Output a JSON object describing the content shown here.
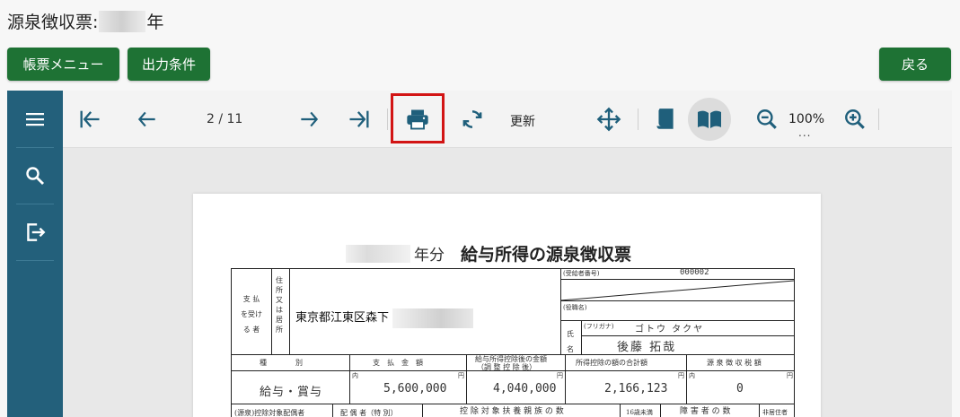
{
  "page": {
    "title_prefix": "源泉徴収票:",
    "title_suffix": "年"
  },
  "buttons": {
    "menu": "帳票メニュー",
    "conditions": "出力条件",
    "back": "戻る"
  },
  "sidebar": {
    "icons": [
      "menu-icon",
      "search-icon",
      "export-icon"
    ]
  },
  "toolbar": {
    "page_indicator": "2 / 11",
    "refresh_label": "更新",
    "zoom_level": "100%",
    "zoom_more": "...",
    "icons": [
      "first-page-icon",
      "prev-page-icon",
      "next-page-icon",
      "last-page-icon",
      "print-icon",
      "refresh-icon",
      "move-icon",
      "single-page-icon",
      "book-view-icon",
      "zoom-out-icon",
      "zoom-in-icon"
    ],
    "highlight_color": "#d21414"
  },
  "document": {
    "year_suffix": "年分",
    "title": "給与所得の源泉徴収票",
    "payer_label": "支 払\nを受け\nる 者",
    "address_label": "住\n所\n又\nは\n居\n所",
    "address": "東京都江東区森下",
    "recipient_no_label": "(受給者番号)",
    "recipient_no": "000002",
    "position_label": "(役職名)",
    "furigana_label": "(フリガナ)",
    "furigana": "ゴトウ タクヤ",
    "name_label": "氏\n名",
    "name": "後藤 拓哉",
    "col_type": "種　　　　別",
    "col_pay": "支　払　金　額",
    "col_deduct_after": "給与所得控除後の金額",
    "col_deduct_after_sub": "（調 整 控 除 後）",
    "col_deduct_total": "所得控除の額の合計額",
    "col_withholding": "源 泉 徴 収 税 額",
    "row_type": "給与・賞与",
    "row_pay": "5,600,000",
    "row_deduct_after": "4,040,000",
    "row_deduct_total": "2,166,123",
    "row_withholding": "0",
    "unit_en": "円",
    "unit_nai": "内",
    "bottom_1": "(源泉)控除対象配偶者",
    "bottom_2": "配 偶 者（特 別）",
    "bottom_3": "控 除 対 象 扶 養 親 族 の 数",
    "bottom_4": "16歳未満",
    "bottom_5": "障 害 者 の 数",
    "bottom_6": "非居住者"
  },
  "colors": {
    "primary_green": "#1e7234",
    "sidebar_blue": "#23607b",
    "icon_blue": "#1f5f7b"
  }
}
